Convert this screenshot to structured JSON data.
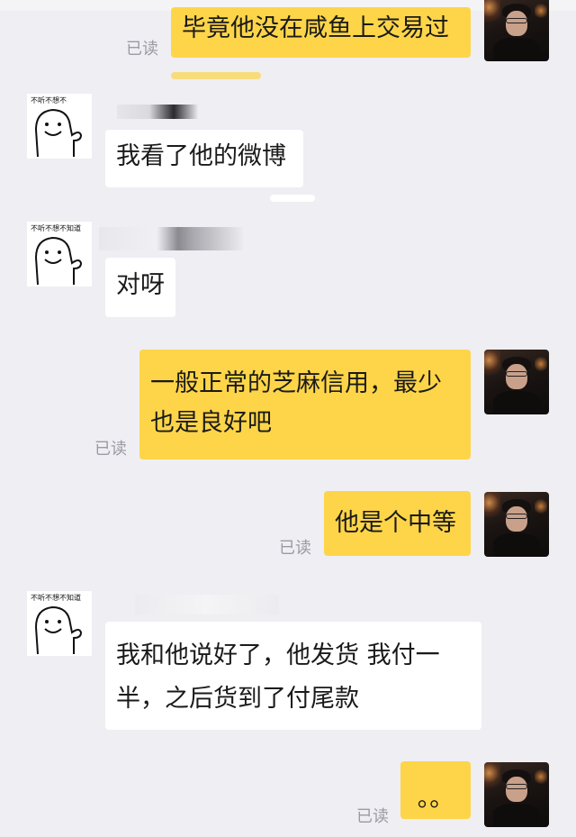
{
  "messages": [
    {
      "id": "m1",
      "sender": "me",
      "text": "毕竟他没在咸鱼上交易过",
      "read": "已读"
    },
    {
      "id": "m2",
      "sender": "them",
      "text": "我看了他的微博",
      "sticker_caption": "不听不想不"
    },
    {
      "id": "m3",
      "sender": "them",
      "text": "对呀",
      "sticker_caption": "不听不想不知道"
    },
    {
      "id": "m4",
      "sender": "me",
      "lines": [
        "一般正常的芝麻信用，最少",
        "也是良好吧"
      ],
      "read": "已读"
    },
    {
      "id": "m5",
      "sender": "me",
      "text": "他是个中等",
      "read": "已读"
    },
    {
      "id": "m6",
      "sender": "them",
      "lines": [
        "我和他说好了，他发货 我付一",
        "半，之后货到了付尾款"
      ],
      "sticker_caption": "不听不想不知道"
    },
    {
      "id": "m7",
      "sender": "me",
      "text": "。。",
      "read": "已读"
    }
  ],
  "icons": {
    "self_avatar": "avatar-photo",
    "other_avatar": "sticker-face-icon"
  },
  "colors": {
    "background": "#eeeef3",
    "my_bubble": "#fed548",
    "their_bubble": "#ffffff",
    "read_text": "#9a9aa2"
  }
}
